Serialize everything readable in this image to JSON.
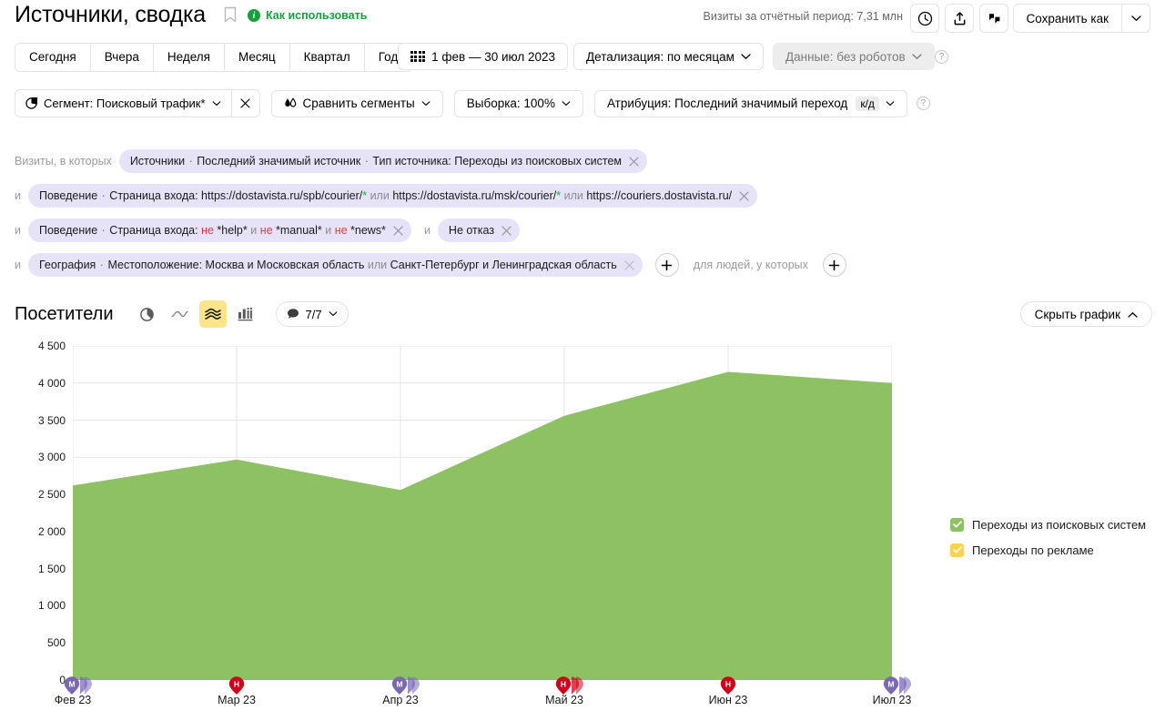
{
  "header": {
    "title": "Источники, сводка",
    "bookmark_icon": "bookmark-icon",
    "howto_label": "Как использовать",
    "visits_summary": "Визиты за отчётный период: 7,31 млн",
    "clock_icon": "clock-icon",
    "export_icon": "export-icon",
    "comment_icon": "comment-quote-icon",
    "save_as_label": "Сохранить как",
    "save_as_caret": "chevron-down-icon"
  },
  "period": {
    "buttons": [
      "Сегодня",
      "Вчера",
      "Неделя",
      "Месяц",
      "Квартал",
      "Год"
    ],
    "date_range": "1 фев — 30 июл 2023",
    "date_range_icon": "calendar-grid-icon",
    "detail": "Детализация: по месяцам",
    "robots": "Данные: без роботов",
    "help_icon": "help-icon"
  },
  "segment_bar": {
    "segment_label": "Сегмент: Поисковый трафик*",
    "segment_icon": "pie-segment-icon",
    "segment_close_icon": "close-icon",
    "compare_label": "Сравнить сегменты",
    "compare_icon": "compare-drops-icon",
    "sample_label": "Выборка: 100%",
    "attribution_label": "Атрибуция: Последний значимый переход",
    "attribution_tag": "к/д",
    "help_icon": "help-icon"
  },
  "filters": {
    "rows": [
      {
        "prefix": "Визиты, в которых",
        "chip": {
          "dimension": "Источники",
          "sub": "Последний значимый источник",
          "text": "Тип источника: Переходы из поисковых систем"
        }
      },
      {
        "prefix": "и",
        "chip": {
          "dimension": "Поведение",
          "text_prefix": "Страница входа: ",
          "parts": [
            {
              "kind": "url",
              "text": "https://dostavista.ru/spb/courier/"
            },
            {
              "kind": "star",
              "text": "*"
            },
            {
              "kind": "op",
              "text": " или "
            },
            {
              "kind": "url",
              "text": "https://dostavista.ru/msk/courier/"
            },
            {
              "kind": "star",
              "text": "*"
            },
            {
              "kind": "op",
              "text": " или "
            },
            {
              "kind": "url",
              "text": "https://couriers.dostavista.ru/"
            }
          ]
        }
      },
      {
        "prefix": "и",
        "chip": {
          "dimension": "Поведение",
          "text_prefix": "Страница входа: ",
          "parts": [
            {
              "kind": "neg",
              "text": "не "
            },
            {
              "kind": "url",
              "text": "*help*"
            },
            {
              "kind": "op",
              "text": " и "
            },
            {
              "kind": "neg",
              "text": "не "
            },
            {
              "kind": "url",
              "text": "*manual*"
            },
            {
              "kind": "op",
              "text": " и "
            },
            {
              "kind": "neg",
              "text": "не "
            },
            {
              "kind": "url",
              "text": "*news*"
            }
          ]
        },
        "extra_prefix": "и",
        "extra_chip": {
          "text": "Не отказ"
        }
      },
      {
        "prefix": "и",
        "chip": {
          "dimension": "География",
          "text_prefix": "Местоположение: ",
          "parts": [
            {
              "kind": "plain",
              "text": "Москва и Московская область"
            },
            {
              "kind": "op",
              "text": " или "
            },
            {
              "kind": "plain",
              "text": "Санкт-Петербург и Ленинградская область"
            }
          ]
        },
        "add_button_icon": "plus-icon",
        "people_label": "для людей, у которых",
        "people_add_icon": "plus-icon"
      }
    ],
    "close_icon": "close-icon"
  },
  "visitors": {
    "title": "Посетители",
    "chart_types": [
      {
        "name": "pie-chart-icon",
        "active": false
      },
      {
        "name": "line-chart-icon",
        "active": false
      },
      {
        "name": "area-chart-icon",
        "active": true
      },
      {
        "name": "bar-chart-icon",
        "active": false
      }
    ],
    "comments_label": "7/7",
    "comments_icon": "comment-bubble-icon",
    "hide_chart_label": "Скрыть график",
    "hide_chart_icon": "chevron-up-icon"
  },
  "colors": {
    "series_green": "#8dc163",
    "series_yellow": "#fcd34d",
    "accent_green": "#15a03c",
    "chip_bg": "#e6e2f7",
    "active_toggle": "#fce588",
    "marker_purple": "#7b68b5",
    "marker_red": "#d0021b"
  },
  "chart_data": {
    "type": "area",
    "title": "Посетители",
    "xlabel": "",
    "ylabel": "",
    "ylim": [
      0,
      4500
    ],
    "ytick_step": 500,
    "yticks": [
      "0",
      "500",
      "1 000",
      "1 500",
      "2 000",
      "2 500",
      "3 000",
      "3 500",
      "4 000",
      "4 500"
    ],
    "grid": true,
    "legend_position": "right",
    "categories": [
      "Фев 23",
      "Мар 23",
      "Апр 23",
      "Май 23",
      "Июн 23",
      "Июл 23"
    ],
    "series": [
      {
        "name": "Переходы из поисковых систем",
        "color": "#8dc163",
        "checked": true,
        "values": [
          2620,
          2970,
          2560,
          3560,
          4150,
          4000
        ]
      },
      {
        "name": "Переходы по рекламе",
        "color": "#fcd34d",
        "checked": true,
        "values": [
          0,
          0,
          0,
          0,
          0,
          0
        ]
      }
    ],
    "markers": [
      {
        "label": "Фев 23",
        "badge": "М",
        "type": "purple",
        "stacked": true
      },
      {
        "label": "Мар 23",
        "badge": "Н",
        "type": "red",
        "stacked": false
      },
      {
        "label": "Апр 23",
        "badge": "М",
        "type": "purple",
        "stacked": true
      },
      {
        "label": "Май 23",
        "badge": "Н",
        "type": "red",
        "stacked": true
      },
      {
        "label": "Июн 23",
        "badge": "Н",
        "type": "red",
        "stacked": false
      },
      {
        "label": "Июл 23",
        "badge": "М",
        "type": "purple",
        "stacked": true
      }
    ]
  }
}
